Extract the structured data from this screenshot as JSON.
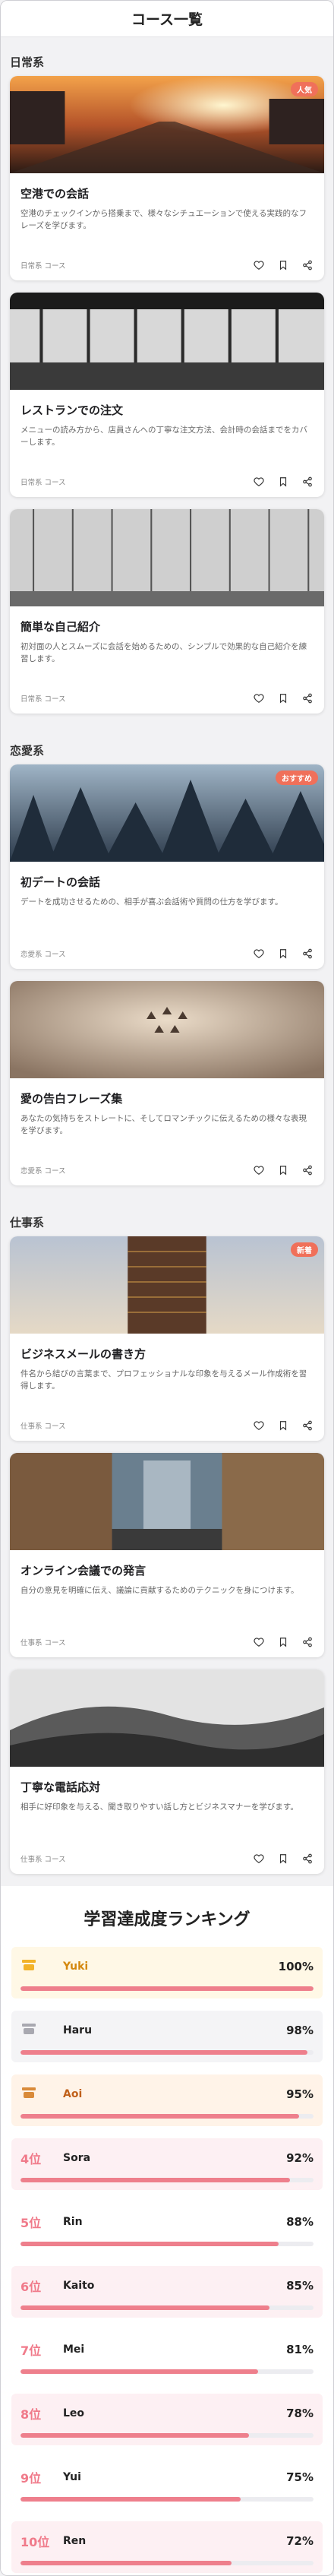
{
  "header": {
    "title": "コース一覧"
  },
  "categories": [
    {
      "name": "日常系",
      "courses": [
        {
          "title": "空港での会話",
          "desc": "空港のチェックインから搭乗まで、様々なシチュエーションで使える実践的なフレーズを学びます。",
          "meta": "日常系 コース",
          "badge": "人気"
        },
        {
          "title": "レストランでの注文",
          "desc": "メニューの読み方から、店員さんへの丁寧な注文方法、会計時の会話までをカバーします。",
          "meta": "日常系 コース"
        },
        {
          "title": "簡単な自己紹介",
          "desc": "初対面の人とスムーズに会話を始めるための、シンプルで効果的な自己紹介を練習します。",
          "meta": "日常系 コース"
        }
      ]
    },
    {
      "name": "恋愛系",
      "courses": [
        {
          "title": "初デートの会話",
          "desc": "デートを成功させるための、相手が喜ぶ会話術や質問の仕方を学びます。",
          "meta": "恋愛系 コース",
          "badge": "おすすめ"
        },
        {
          "title": "愛の告白フレーズ集",
          "desc": "あなたの気持ちをストレートに、そしてロマンチックに伝えるための様々な表現を学びます。",
          "meta": "恋愛系 コース"
        }
      ]
    },
    {
      "name": "仕事系",
      "courses": [
        {
          "title": "ビジネスメールの書き方",
          "desc": "件名から結びの言葉まで、プロフェッショナルな印象を与えるメール作成術を習得します。",
          "meta": "仕事系 コース",
          "badge": "新着"
        },
        {
          "title": "オンライン会議での発言",
          "desc": "自分の意見を明確に伝え、議論に貢献するためのテクニックを身につけます。",
          "meta": "仕事系 コース"
        },
        {
          "title": "丁寧な電話応対",
          "desc": "相手に好印象を与える、聞き取りやすい話し方とビジネスマナーを学びます。",
          "meta": "仕事系 コース"
        }
      ]
    }
  ],
  "ranking": {
    "title": "学習達成度ランキング",
    "entries": [
      {
        "pos": "",
        "icon": "gold-medal-icon",
        "name": "Yuki",
        "pct": "100%",
        "value": 1.0,
        "bg": "#fff8e6",
        "nameColor": "#d4880e"
      },
      {
        "pos": "",
        "icon": "silver-medal-icon",
        "name": "Haru",
        "pct": "98%",
        "value": 0.98,
        "bg": "#f4f4f6",
        "nameColor": "#222222"
      },
      {
        "pos": "",
        "icon": "bronze-medal-icon",
        "name": "Aoi",
        "pct": "95%",
        "value": 0.95,
        "bg": "#fff3e8",
        "nameColor": "#c0601a"
      },
      {
        "pos": "4位",
        "name": "Sora",
        "pct": "92%",
        "value": 0.92,
        "bg": "#fdf0f3",
        "nameColor": "#222222"
      },
      {
        "pos": "5位",
        "name": "Rin",
        "pct": "88%",
        "value": 0.88,
        "bg": "#ffffff",
        "nameColor": "#222222"
      },
      {
        "pos": "6位",
        "name": "Kaito",
        "pct": "85%",
        "value": 0.85,
        "bg": "#fdf0f3",
        "nameColor": "#222222"
      },
      {
        "pos": "7位",
        "name": "Mei",
        "pct": "81%",
        "value": 0.81,
        "bg": "#ffffff",
        "nameColor": "#222222"
      },
      {
        "pos": "8位",
        "name": "Leo",
        "pct": "78%",
        "value": 0.78,
        "bg": "#fdf0f3",
        "nameColor": "#222222"
      },
      {
        "pos": "9位",
        "name": "Yui",
        "pct": "75%",
        "value": 0.75,
        "bg": "#ffffff",
        "nameColor": "#222222"
      },
      {
        "pos": "10位",
        "name": "Ren",
        "pct": "72%",
        "value": 0.72,
        "bg": "#fdf0f3",
        "nameColor": "#222222"
      }
    ]
  },
  "colors": {
    "accent": "#ee7f8c",
    "rank_text": "#f07a8a",
    "badge": "#f0705a"
  },
  "icons": {
    "like": "heart-icon",
    "save": "bookmark-icon",
    "share": "share-icon"
  }
}
